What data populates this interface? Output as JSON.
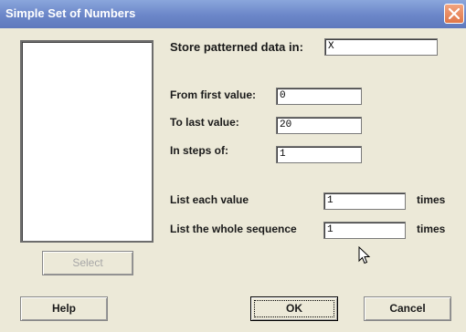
{
  "window": {
    "title": "Simple Set of Numbers"
  },
  "labels": {
    "store": "Store patterned data in:",
    "from": "From first value:",
    "to": "To last value:",
    "steps": "In steps of:",
    "list_each": "List each value",
    "list_whole": "List the whole sequence",
    "times1": "times",
    "times2": "times"
  },
  "values": {
    "store": "X",
    "from": "0",
    "to": "20",
    "steps": "1",
    "list_each": "1",
    "list_whole": "1"
  },
  "buttons": {
    "select": "Select",
    "help": "Help",
    "ok": "OK",
    "cancel": "Cancel"
  },
  "icons": {
    "close": "close-icon",
    "cursor": "mouse-pointer-icon"
  }
}
